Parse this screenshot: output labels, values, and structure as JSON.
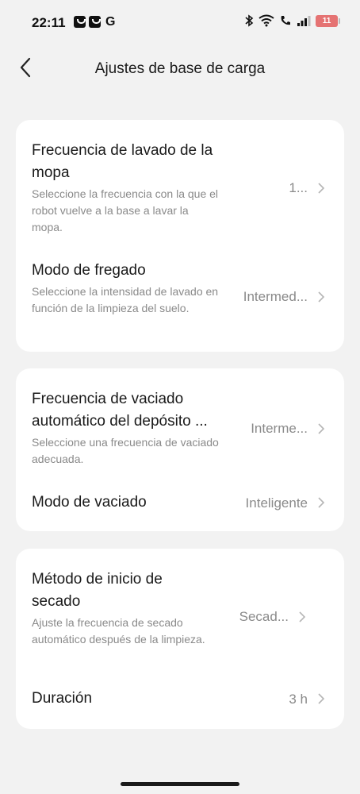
{
  "status_bar": {
    "time": "22:11",
    "notification_letter": "G",
    "battery_level": "11",
    "battery_color": "#e57373"
  },
  "header": {
    "title": "Ajustes de base de carga"
  },
  "cards": [
    {
      "rows": [
        {
          "title": " Frecuencia de lavado de la mopa",
          "subtitle": "Seleccione la frecuencia con la que el robot vuelve a la base a lavar la mopa.",
          "value": "1..."
        },
        {
          "title": "Modo de fregado",
          "subtitle": "Seleccione la intensidad de lavado en función de la limpieza del suelo.",
          "value": "Intermed..."
        }
      ]
    },
    {
      "rows": [
        {
          "title": "Frecuencia de vaciado automático del depósito ...",
          "subtitle": "Seleccione una frecuencia de vaciado adecuada.",
          "value": "Interme..."
        },
        {
          "title": "Modo de vaciado",
          "subtitle": "",
          "value": "Inteligente"
        }
      ]
    },
    {
      "rows": [
        {
          "title": "Método de inicio de secado",
          "subtitle": "Ajuste la frecuencia de secado automático después de la limpieza.",
          "value": "Secad..."
        },
        {
          "title": "Duración",
          "subtitle": "",
          "value": "3 h"
        }
      ]
    }
  ]
}
